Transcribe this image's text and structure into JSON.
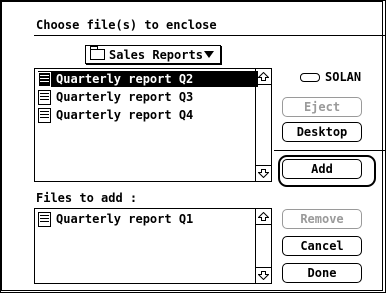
{
  "dialog": {
    "title": "Choose file(s) to enclose",
    "folder_popup": {
      "label": "Sales Reports"
    },
    "drive": {
      "label": "SOLAN"
    },
    "file_list": [
      {
        "name": "Quarterly report Q2",
        "selected": true
      },
      {
        "name": "Quarterly report Q3",
        "selected": false
      },
      {
        "name": "Quarterly report Q4",
        "selected": false
      }
    ],
    "files_to_add_label": "Files to add :",
    "files_to_add": [
      {
        "name": "Quarterly report Q1"
      }
    ],
    "buttons": {
      "eject": {
        "label": "Eject",
        "enabled": false
      },
      "desktop": {
        "label": "Desktop",
        "enabled": true
      },
      "add": {
        "label": "Add",
        "enabled": true
      },
      "remove": {
        "label": "Remove",
        "enabled": false
      },
      "cancel": {
        "label": "Cancel",
        "enabled": true
      },
      "done": {
        "label": "Done",
        "enabled": true
      }
    }
  }
}
